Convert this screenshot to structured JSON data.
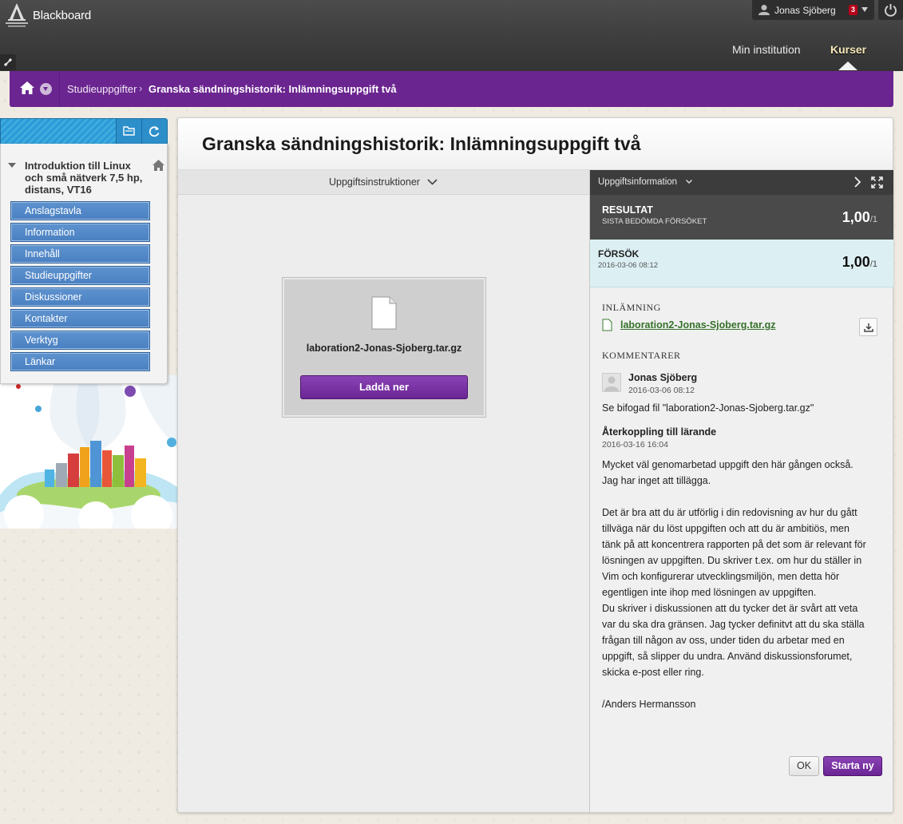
{
  "header": {
    "logo_text": "Blackboard",
    "user_name": "Jonas Sjöberg",
    "notification_count": "3",
    "tabs": [
      {
        "label": "Min institution"
      },
      {
        "label": "Kurser"
      }
    ]
  },
  "breadcrumb": {
    "items": [
      {
        "label": "Studieuppgifter"
      },
      {
        "label": "Granska sändningshistorik: Inlämningsuppgift två"
      }
    ],
    "separator": "›"
  },
  "course_menu": {
    "title_lines": [
      "Introduktion till Linux",
      "och små nätverk 7,5 hp,",
      "distans, VT16"
    ],
    "items": [
      {
        "label": "Anslagstavla"
      },
      {
        "label": "Information"
      },
      {
        "label": "Innehåll"
      },
      {
        "label": "Studieuppgifter"
      },
      {
        "label": "Diskussioner"
      },
      {
        "label": "Kontakter"
      },
      {
        "label": "Verktyg"
      },
      {
        "label": "Länkar"
      }
    ]
  },
  "main": {
    "page_title": "Granska sändningshistorik: Inlämningsuppgift två",
    "instructions_label": "Uppgiftsinstruktioner",
    "file_name": "laboration2-Jonas-Sjoberg.tar.gz",
    "download_label": "Ladda ner"
  },
  "info": {
    "header_label": "Uppgiftsinformation",
    "grade_label": "RESULTAT",
    "grade_sub": "SISTA BEDÖMDA FÖRSÖKET",
    "grade_value": "1,00",
    "grade_denominator": "/1",
    "attempt_label": "FÖRSÖK",
    "attempt_date": "2016-03-06 08:12",
    "attempt_value": "1,00",
    "attempt_denominator": "/1",
    "submission_heading": "INLÄMNING",
    "submission_file": "laboration2-Jonas-Sjoberg.tar.gz",
    "comments_heading": "KOMMENTARER",
    "comment_author": "Jonas Sjöberg",
    "comment_date": "2016-03-06 08:12",
    "comment_text": "Se bifogad fil \"laboration2-Jonas-Sjoberg.tar.gz\"",
    "feedback_title": "Återkoppling till lärande",
    "feedback_date": "2016-03-16 16:04",
    "feedback_lines": [
      "Mycket väl genomarbetad uppgift den här gången också.",
      "Jag har inget att tillägga.",
      "",
      "Det är bra att du är utförlig i din redovisning av hur du gått",
      "tillväga när du löst uppgiften och att du är ambitiös, men",
      "tänk på att koncentrera rapporten på det som är relevant för",
      "lösningen av uppgiften. Du skriver t.ex. om hur du ställer in",
      "Vim och konfigurerar utvecklingsmiljön, men detta hör",
      "egentligen inte ihop med lösningen av uppgiften.",
      "Du skriver i diskussionen att du tycker det är svårt att veta",
      "var du ska dra gränsen. Jag tycker definitvt att du ska ställa",
      "frågan till någon av oss, under tiden du arbetar med en",
      "uppgift, så slipper du undra. Använd diskussionsforumet,",
      "skicka e-post eller ring.",
      "",
      "/Anders Hermansson"
    ],
    "ok_label": "OK",
    "restart_label": "Starta ny"
  },
  "colors": {
    "brand_purple": "#6b2590",
    "menu_blue": "#4a80c1",
    "header_dark": "#3c3c3c",
    "attempt_bg": "#dcf0f4",
    "link_green": "#36712b"
  },
  "icons": [
    "university-logo-icon",
    "user-icon",
    "power-icon",
    "link-icon",
    "home-icon",
    "chevron-down-icon",
    "folder-icon",
    "refresh-icon",
    "document-icon",
    "chevron-right-icon",
    "expand-icon",
    "download-icon"
  ]
}
